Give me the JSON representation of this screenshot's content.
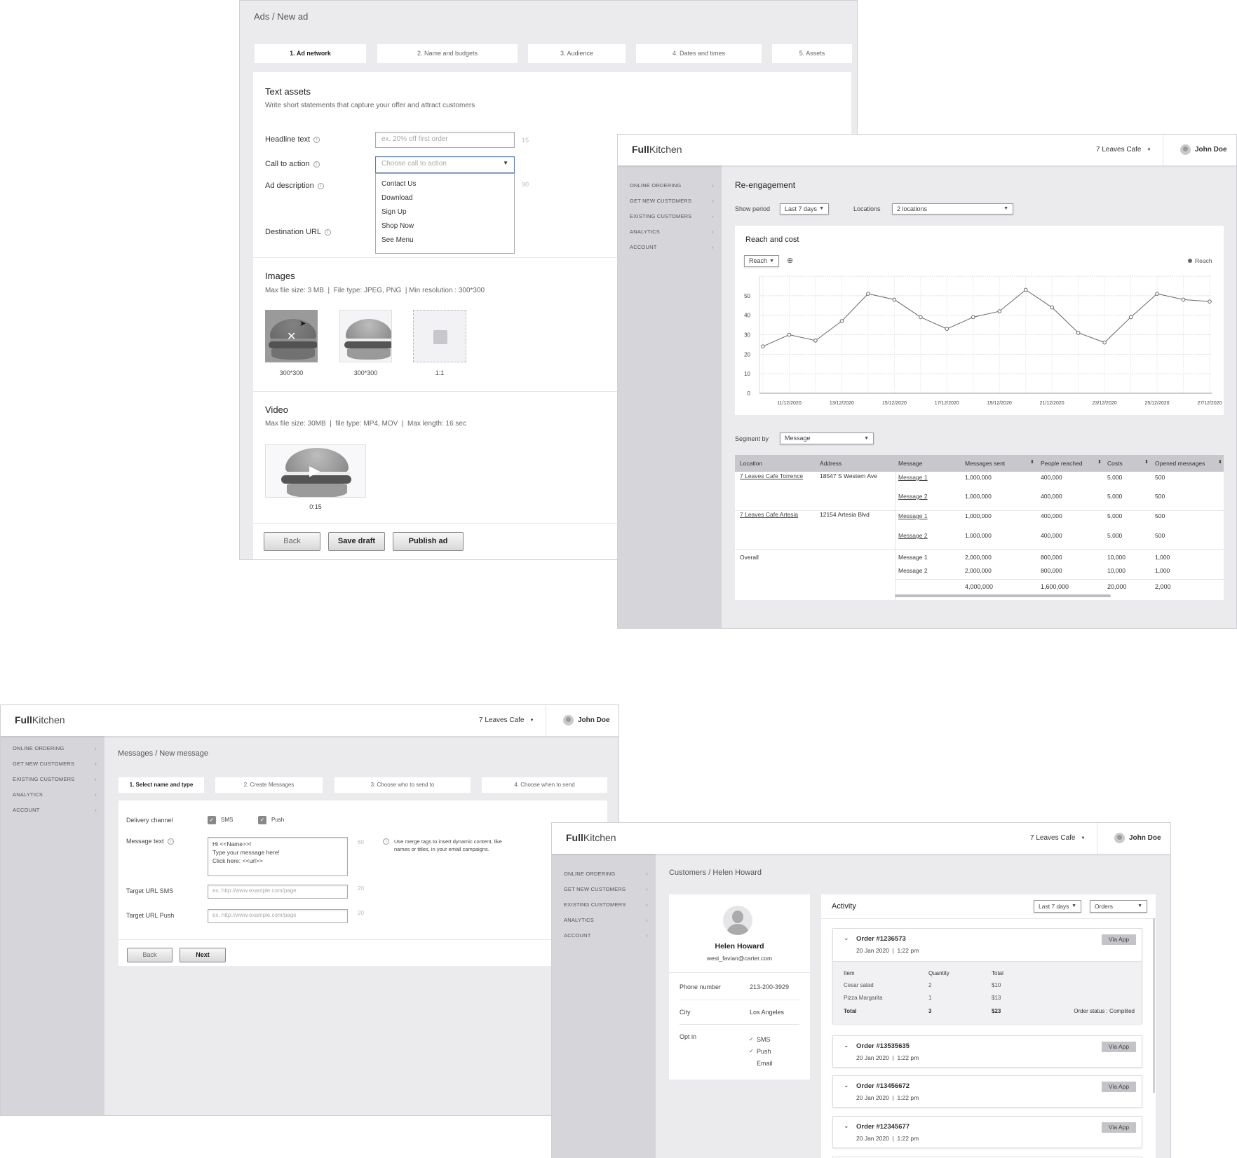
{
  "app": {
    "logo_bold": "Full",
    "logo_light": "Kitchen",
    "location": "7 Leaves Cafe",
    "user": "John Doe",
    "sidebar": [
      "ONLINE ORDERING",
      "GET NEW CUSTOMERS",
      "EXISTING CUSTOMERS",
      "ANALYTICS",
      "ACCOUNT"
    ]
  },
  "ads": {
    "breadcrumb": "Ads / New ad",
    "tabs": [
      "1. Ad network",
      "2. Name and budgets",
      "3.  Audience",
      "4. Dates and times",
      "5. Assets"
    ],
    "text_assets": {
      "title": "Text assets",
      "subtitle": "Write short statements that capture your offer and attract customers",
      "headline_label": "Headline text",
      "headline_placeholder": "ex. 20% off first order",
      "headline_count": "15",
      "cta_label": "Call to action",
      "cta_placeholder": "Choose call to action",
      "cta_options": [
        "Contact Us",
        "Download",
        "Sign Up",
        "Shop Now",
        "See Menu"
      ],
      "description_label": "Ad description",
      "description_count": "90",
      "url_label": "Destination URL"
    },
    "images": {
      "title": "Images",
      "subtitle": "Max file size: 3 MB  |  File type: JPEG, PNG  | Min resolution : 300*300",
      "items": [
        "300*300",
        "300*300",
        "1:1"
      ]
    },
    "video": {
      "title": "Video",
      "subtitle": "Max file size: 30MB  |  file type: MP4, MOV  |  Max length: 16 sec",
      "duration": "0:15"
    },
    "buttons": {
      "back": "Back",
      "save": "Save draft",
      "publish": "Publish ad"
    }
  },
  "reengagement": {
    "title": "Re-engagement",
    "show_period_label": "Show period",
    "show_period_value": "Last 7 days",
    "locations_label": "Locations",
    "locations_value": "2 locations",
    "segment_label": "Segment by",
    "segment_value": "Message",
    "table": {
      "headers": [
        "Location",
        "Address",
        "Message",
        "Messages sent",
        "People reached",
        "Costs",
        "Opened messages"
      ],
      "groups": [
        {
          "location": "7 Leaves Cafe Torrence",
          "address": "18547 S Western Ave",
          "rows": [
            [
              "Message 1",
              "1,000,000",
              "400,000",
              "5,000",
              "500"
            ],
            [
              "Message 2",
              "1,000,000",
              "400,000",
              "5,000",
              "500"
            ]
          ]
        },
        {
          "location": "7 Leaves Cafe Artesia",
          "address": "12154 Artesia Blvd",
          "rows": [
            [
              "Message 1",
              "1,000,000",
              "400,000",
              "5,000",
              "500"
            ],
            [
              "Message 2",
              "1,000,000",
              "400,000",
              "5,000",
              "500"
            ]
          ]
        }
      ],
      "overall": {
        "label": "Overall",
        "rows": [
          [
            "Message 1",
            "2,000,000",
            "800,000",
            "10,000",
            "1,000"
          ],
          [
            "Message 2",
            "2,000,000",
            "800,000",
            "10,000",
            "1,000"
          ]
        ],
        "total": [
          "",
          "4,000,000",
          "1,600,000",
          "20,000",
          "2,000"
        ]
      }
    }
  },
  "chart_data": {
    "type": "line",
    "title": "Reach and cost",
    "metric_select": "Reach",
    "legend": "top-right",
    "grid": true,
    "x": [
      "10/12/2020",
      "11/12/2020",
      "12/12/2020",
      "13/12/2020",
      "14/12/2020",
      "15/12/2020",
      "16/12/2020",
      "17/12/2020",
      "18/12/2020",
      "19/12/2020",
      "20/12/2020",
      "21/12/2020",
      "22/12/2020",
      "23/12/2020",
      "24/12/2020",
      "25/12/2020",
      "26/12/2020",
      "27/12/2020"
    ],
    "x_tick_labels": [
      "11/12/2020",
      "13/12/2020",
      "15/12/2020",
      "17/12/2020",
      "19/12/2020",
      "21/12/2020",
      "23/12/2020",
      "25/12/2020",
      "27/12/2020"
    ],
    "y_ticks": [
      0,
      10,
      20,
      30,
      40,
      50
    ],
    "ylim": [
      0,
      60
    ],
    "series": [
      {
        "name": "Reach",
        "color": "#666666",
        "values": [
          24,
          30,
          27,
          37,
          51,
          48,
          39,
          33,
          39,
          42,
          53,
          44,
          31,
          26,
          39,
          51,
          48,
          47
        ]
      }
    ]
  },
  "messages": {
    "breadcrumb": "Messages / New message",
    "tabs": [
      "1. Select name and type",
      "2. Create Messages",
      "3. Choose who to send to",
      "4. Choose when to send"
    ],
    "delivery_label": "Delivery channel",
    "channels": [
      {
        "label": "SMS",
        "checked": true
      },
      {
        "label": "Push",
        "checked": true
      }
    ],
    "message_label": "Message text",
    "message_value": "Hi <<Name>>!\nType your message here!\nClick here:  <<url>>",
    "message_count": "60",
    "merge_note": "Use merge tags to insert dynamic content, like names or titles, in your email campaigns.",
    "sms_label": "Target URL SMS",
    "push_label": "Target URL Push",
    "url_placeholder": "ex. http://www.example.com/page",
    "url_count": "20",
    "back": "Back",
    "next": "Next"
  },
  "customer": {
    "breadcrumb": "Customers / Helen Howard",
    "name": "Helen Howard",
    "email": "west_favian@carter.com",
    "phone_label": "Phone number",
    "phone": "213-200-3929",
    "city_label": "City",
    "city": "Los Angeles",
    "optin_label": "Opt in",
    "optins": [
      {
        "label": "SMS",
        "checked": true
      },
      {
        "label": "Push",
        "checked": true
      },
      {
        "label": "Email",
        "checked": false
      }
    ],
    "activity_title": "Activity",
    "period": "Last 7 days",
    "filter": "Orders",
    "orders": [
      {
        "number": "Order #1236573",
        "date": "20 Jan 2020  |  1:22 pm",
        "channel": "Via App",
        "expanded": true
      },
      {
        "number": "Order #13535635",
        "date": "20 Jan 2020  |  1:22 pm",
        "channel": "Via App"
      },
      {
        "number": "Order #13456672",
        "date": "20 Jan 2020  |  1:22 pm",
        "channel": "Via App"
      },
      {
        "number": "Order #12345677",
        "date": "20 Jan 2020  |  1:22 pm",
        "channel": "Via App"
      }
    ],
    "order_detail": {
      "headers": [
        "Item",
        "Quantity",
        "Total"
      ],
      "items": [
        [
          "Cesar salad",
          "2",
          "$10"
        ],
        [
          "Pizza Margarita",
          "1",
          "$13"
        ]
      ],
      "total": [
        "Total",
        "3",
        "$23"
      ],
      "status": "Order status : Complited"
    }
  }
}
